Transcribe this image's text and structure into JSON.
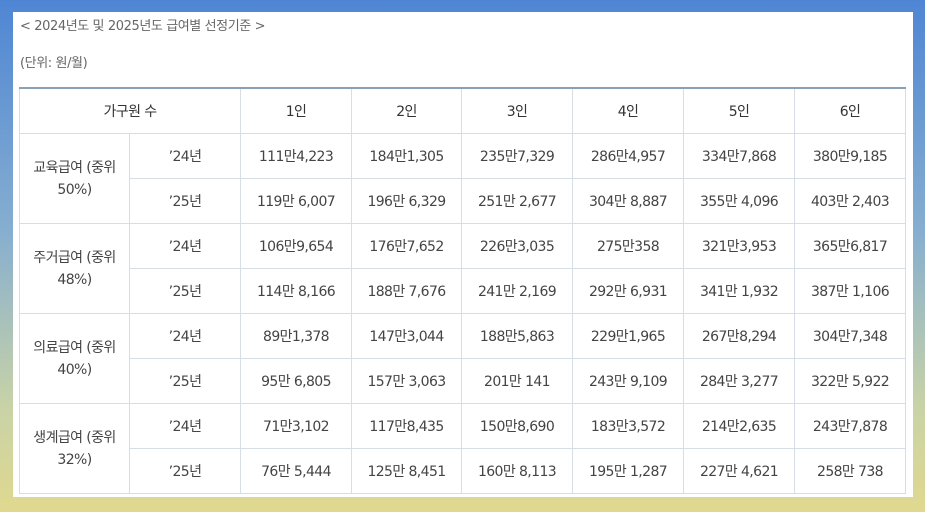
{
  "title": "< 2024년도 및 2025년도 급여별 선정기준 >",
  "unit": "(단위: 원/월)",
  "header": {
    "household": "가구원 수",
    "cols": [
      "1인",
      "2인",
      "3인",
      "4인",
      "5인",
      "6인"
    ]
  },
  "groups": [
    {
      "label": "교육급여 (중위 50%)",
      "rows": [
        {
          "year": "’24년",
          "values": [
            "111만4,223",
            "184만1,305",
            "235만7,329",
            "286만4,957",
            "334만7,868",
            "380만9,185"
          ]
        },
        {
          "year": "’25년",
          "values": [
            "119만 6,007",
            "196만 6,329",
            "251만 2,677",
            "304만 8,887",
            "355만 4,096",
            "403만 2,403"
          ]
        }
      ]
    },
    {
      "label": "주거급여 (중위 48%)",
      "rows": [
        {
          "year": "’24년",
          "values": [
            "106만9,654",
            "176만7,652",
            "226만3,035",
            "275만358",
            "321만3,953",
            "365만6,817"
          ]
        },
        {
          "year": "’25년",
          "values": [
            "114만 8,166",
            "188만 7,676",
            "241만 2,169",
            "292만 6,931",
            "341만 1,932",
            "387만 1,106"
          ]
        }
      ]
    },
    {
      "label": "의료급여 (중위 40%)",
      "rows": [
        {
          "year": "’24년",
          "values": [
            "89만1,378",
            "147만3,044",
            "188만5,863",
            "229만1,965",
            "267만8,294",
            "304만7,348"
          ]
        },
        {
          "year": "’25년",
          "values": [
            "95만 6,805",
            "157만 3,063",
            "201만 141",
            "243만 9,109",
            "284만 3,277",
            "322만 5,922"
          ]
        }
      ]
    },
    {
      "label": "생계급여 (중위 32%)",
      "rows": [
        {
          "year": "’24년",
          "values": [
            "71만3,102",
            "117만8,435",
            "150만8,690",
            "183만3,572",
            "214만2,635",
            "243만7,878"
          ]
        },
        {
          "year": "’25년",
          "values": [
            "76만 5,444",
            "125만 8,451",
            "160만 8,113",
            "195만 1,287",
            "227만 4,621",
            "258만 738"
          ]
        }
      ]
    }
  ]
}
